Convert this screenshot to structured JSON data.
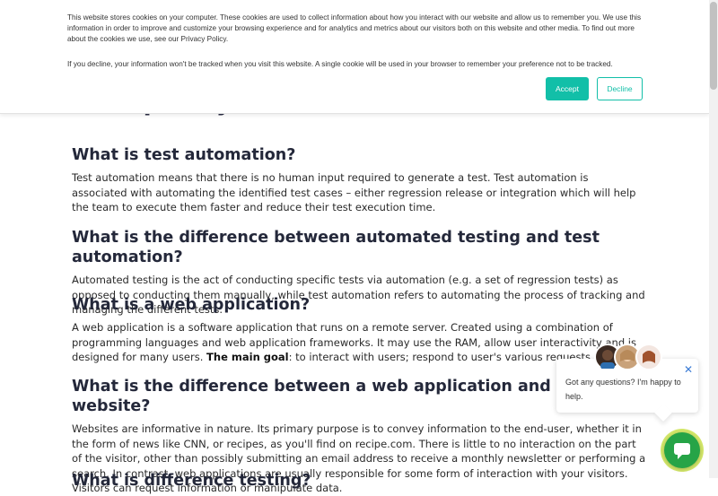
{
  "cookie_banner": {
    "text1": "This website stores cookies on your computer. These cookies are used to collect information about how you interact with our website and allow us to remember you. We use this information in order to improve and customize your browsing experience and for analytics and metrics about our visitors both on this website and other media. To find out more about the cookies we use, see our Privacy Policy.",
    "text2": "If you decline, your information won't be tracked when you visit this website. A single cookie will be used in your browser to remember your preference not to be tracked.",
    "accept_label": "Accept",
    "decline_label": "Decline"
  },
  "sections": [
    {
      "heading": "What is test automation?",
      "body": "Test automation means that there is no human input required to generate a test. Test automation is associated with automating the identified test cases – either regression release or integration which will help the team to execute them faster and reduce their test execution time."
    },
    {
      "heading": "What is the difference between automated testing and test automation?",
      "body": "Automated testing is the act of conducting specific tests via automation (e.g. a set of regression tests) as opposed to conducting them manually, while test automation refers to automating the process of tracking and managing the different tests."
    },
    {
      "heading": "What is a web application?",
      "body": "A web application is a software application that runs on a remote server. Created using a combination of programming languages and web application frameworks. It may use the RAM, allow user interactivity and is designed for many users.",
      "bold": "The main goal",
      "body_after": ": to interact with users; respond to user's various requests"
    },
    {
      "heading": "What is the difference between a web application and a website?",
      "body": "Websites are informative in nature. Its primary purpose is to convey information to the end-user, whether it in the form of news like CNN, or recipes, as you'll find on recipe.com. There is little to no interaction on the part of the visitor, other than possibly submitting an email address to receive a monthly newsletter or performing a search. In contrast, web applications are usually responsible for some form of interaction with your visitors. Visitors can request information or manipulate data."
    },
    {
      "heading": "What is difference testing?"
    }
  ],
  "chat": {
    "message": "Got any questions? I'm happy to help.",
    "close_symbol": "✕"
  },
  "colors": {
    "accent": "#12bfa8",
    "chat_green": "#26a447"
  }
}
